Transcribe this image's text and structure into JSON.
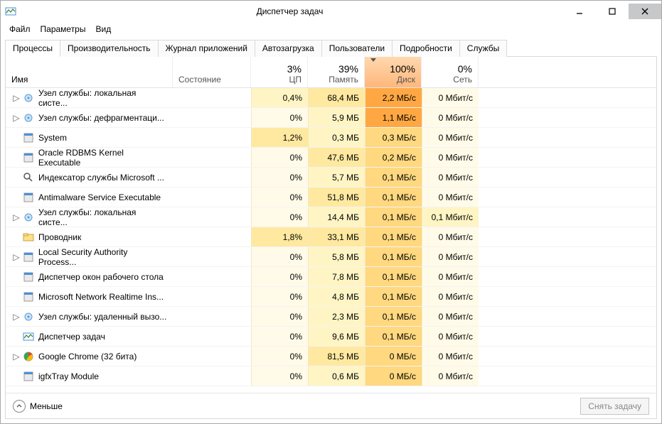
{
  "window": {
    "title": "Диспетчер задач"
  },
  "menu": {
    "file": "Файл",
    "options": "Параметры",
    "view": "Вид"
  },
  "tabs": [
    {
      "label": "Процессы"
    },
    {
      "label": "Производительность"
    },
    {
      "label": "Журнал приложений"
    },
    {
      "label": "Автозагрузка"
    },
    {
      "label": "Пользователи"
    },
    {
      "label": "Подробности"
    },
    {
      "label": "Службы"
    }
  ],
  "columns": {
    "name": "Имя",
    "status": "Состояние",
    "cpu": {
      "pct": "3%",
      "label": "ЦП"
    },
    "mem": {
      "pct": "39%",
      "label": "Память"
    },
    "disk": {
      "pct": "100%",
      "label": "Диск"
    },
    "net": {
      "pct": "0%",
      "label": "Сеть"
    }
  },
  "footer": {
    "fewer": "Меньше",
    "endtask": "Снять задачу"
  },
  "processes": [
    {
      "exp": true,
      "icon": "gear",
      "name": "Узел службы: локальная систе...",
      "cpu": "0,4%",
      "cpu_h": "h1",
      "mem": "68,4 МБ",
      "mem_h": "h2",
      "disk": "2,2 МБ/с",
      "disk_h": "h5",
      "net": "0 Мбит/с",
      "net_h": "h0"
    },
    {
      "exp": true,
      "icon": "gear",
      "name": "Узел службы: дефрагментаци...",
      "cpu": "0%",
      "cpu_h": "h0",
      "mem": "5,9 МБ",
      "mem_h": "h1",
      "disk": "1,1 МБ/с",
      "disk_h": "h5",
      "net": "0 Мбит/с",
      "net_h": "h0"
    },
    {
      "exp": false,
      "icon": "app",
      "name": "System",
      "cpu": "1,2%",
      "cpu_h": "h2",
      "mem": "0,3 МБ",
      "mem_h": "h1",
      "disk": "0,3 МБ/с",
      "disk_h": "h3",
      "net": "0 Мбит/с",
      "net_h": "h0"
    },
    {
      "exp": false,
      "icon": "app",
      "name": "Oracle RDBMS Kernel Executable",
      "cpu": "0%",
      "cpu_h": "h0",
      "mem": "47,6 МБ",
      "mem_h": "h2",
      "disk": "0,2 МБ/с",
      "disk_h": "h3",
      "net": "0 Мбит/с",
      "net_h": "h0"
    },
    {
      "exp": false,
      "icon": "index",
      "name": "Индексатор службы Microsoft ...",
      "cpu": "0%",
      "cpu_h": "h0",
      "mem": "5,7 МБ",
      "mem_h": "h1",
      "disk": "0,1 МБ/с",
      "disk_h": "h3",
      "net": "0 Мбит/с",
      "net_h": "h0"
    },
    {
      "exp": false,
      "icon": "app",
      "name": "Antimalware Service Executable",
      "cpu": "0%",
      "cpu_h": "h0",
      "mem": "51,8 МБ",
      "mem_h": "h2",
      "disk": "0,1 МБ/с",
      "disk_h": "h3",
      "net": "0 Мбит/с",
      "net_h": "h0"
    },
    {
      "exp": true,
      "icon": "gear",
      "name": "Узел службы: локальная систе...",
      "cpu": "0%",
      "cpu_h": "h0",
      "mem": "14,4 МБ",
      "mem_h": "h1",
      "disk": "0,1 МБ/с",
      "disk_h": "h3",
      "net": "0,1 Мбит/с",
      "net_h": "h1"
    },
    {
      "exp": false,
      "icon": "explorer",
      "name": "Проводник",
      "cpu": "1,8%",
      "cpu_h": "h2",
      "mem": "33,1 МБ",
      "mem_h": "h2",
      "disk": "0,1 МБ/с",
      "disk_h": "h3",
      "net": "0 Мбит/с",
      "net_h": "h0"
    },
    {
      "exp": true,
      "icon": "app",
      "name": "Local Security Authority Process...",
      "cpu": "0%",
      "cpu_h": "h0",
      "mem": "5,8 МБ",
      "mem_h": "h1",
      "disk": "0,1 МБ/с",
      "disk_h": "h3",
      "net": "0 Мбит/с",
      "net_h": "h0"
    },
    {
      "exp": false,
      "icon": "app",
      "name": "Диспетчер окон рабочего стола",
      "cpu": "0%",
      "cpu_h": "h0",
      "mem": "7,8 МБ",
      "mem_h": "h1",
      "disk": "0,1 МБ/с",
      "disk_h": "h3",
      "net": "0 Мбит/с",
      "net_h": "h0"
    },
    {
      "exp": false,
      "icon": "app",
      "name": "Microsoft Network Realtime Ins...",
      "cpu": "0%",
      "cpu_h": "h0",
      "mem": "4,8 МБ",
      "mem_h": "h1",
      "disk": "0,1 МБ/с",
      "disk_h": "h3",
      "net": "0 Мбит/с",
      "net_h": "h0"
    },
    {
      "exp": true,
      "icon": "gear",
      "name": "Узел службы: удаленный вызо...",
      "cpu": "0%",
      "cpu_h": "h0",
      "mem": "2,3 МБ",
      "mem_h": "h1",
      "disk": "0,1 МБ/с",
      "disk_h": "h3",
      "net": "0 Мбит/с",
      "net_h": "h0"
    },
    {
      "exp": false,
      "icon": "tm",
      "name": "Диспетчер задач",
      "cpu": "0%",
      "cpu_h": "h0",
      "mem": "9,6 МБ",
      "mem_h": "h1",
      "disk": "0,1 МБ/с",
      "disk_h": "h3",
      "net": "0 Мбит/с",
      "net_h": "h0"
    },
    {
      "exp": true,
      "icon": "chrome",
      "name": "Google Chrome (32 бита)",
      "cpu": "0%",
      "cpu_h": "h0",
      "mem": "81,5 МБ",
      "mem_h": "h2",
      "disk": "0 МБ/с",
      "disk_h": "h3",
      "net": "0 Мбит/с",
      "net_h": "h0"
    },
    {
      "exp": false,
      "icon": "app",
      "name": "igfxTray Module",
      "cpu": "0%",
      "cpu_h": "h0",
      "mem": "0,6 МБ",
      "mem_h": "h1",
      "disk": "0 МБ/с",
      "disk_h": "h3",
      "net": "0 Мбит/с",
      "net_h": "h0"
    }
  ]
}
